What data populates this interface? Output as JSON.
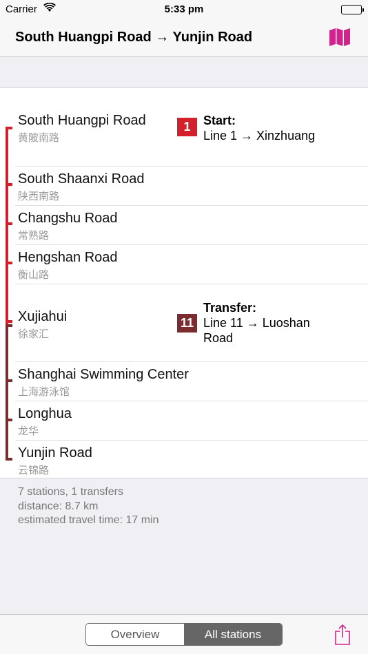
{
  "status_bar": {
    "carrier": "Carrier",
    "time": "5:33 pm"
  },
  "nav": {
    "title": "South Huangpi Road → Yunjin Road",
    "map_icon": "map-icon"
  },
  "colors": {
    "line1": "#d4202a",
    "line11": "#7a2c2f",
    "accent": "#d1238b"
  },
  "stations": [
    {
      "name": "South Huangpi Road",
      "name_cn": "黄陂南路"
    },
    {
      "name": "South Shaanxi Road",
      "name_cn": "陕西南路"
    },
    {
      "name": "Changshu Road",
      "name_cn": "常熟路"
    },
    {
      "name": "Hengshan Road",
      "name_cn": "衡山路"
    },
    {
      "name": "Xujiahui",
      "name_cn": "徐家汇"
    },
    {
      "name": "Shanghai Swimming Center",
      "name_cn": "上海游泳馆"
    },
    {
      "name": "Longhua",
      "name_cn": "龙华"
    },
    {
      "name": "Yunjin Road",
      "name_cn": "云锦路"
    }
  ],
  "events": {
    "start": {
      "badge": "1",
      "title": "Start:",
      "detail": "Line 1 → Xinzhuang"
    },
    "transfer": {
      "badge": "11",
      "title": "Transfer:",
      "detail": "Line 11 → Luoshan Road"
    }
  },
  "summary": {
    "stations": "7 stations, 1 transfers",
    "distance": "distance: 8.7 km",
    "time": "estimated travel time: 17 min"
  },
  "toolbar": {
    "segments": [
      "Overview",
      "All stations"
    ],
    "selected": "All stations",
    "share_icon": "share-icon"
  }
}
